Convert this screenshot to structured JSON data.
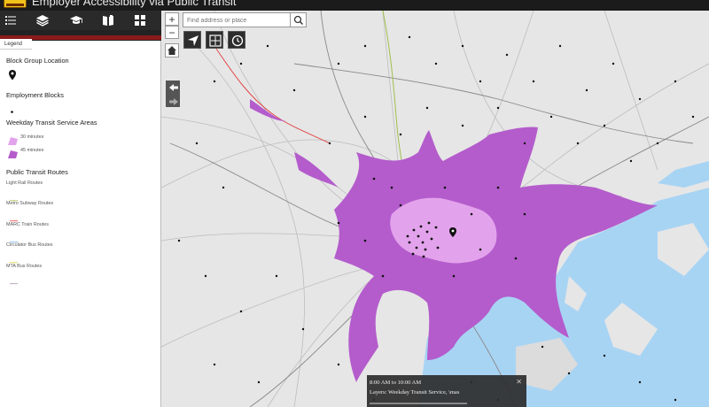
{
  "app": {
    "title": "Employer Accessibility via Public Transit"
  },
  "toolbar": {
    "icons": [
      "legend-list-icon",
      "layers-icon",
      "graduation-cap-icon",
      "bookmark-icon",
      "basemap-grid-icon"
    ]
  },
  "legend": {
    "tab_label": "Legend",
    "sections": [
      {
        "heading": "Block Group Location",
        "items": []
      },
      {
        "heading": "Employment Blocks",
        "items": []
      },
      {
        "heading": "Weekday Transit Service Areas",
        "items": [
          "30 minutes",
          "45 minutes"
        ]
      },
      {
        "heading": "Public Transit Routes",
        "items": [
          "Light Rail Routes",
          "Metro Subway Routes",
          "MARC Train Routes",
          "Circulator Bus Routes",
          "MTA Bus Routes"
        ]
      }
    ],
    "colors": {
      "light_rail": "#c9d98a",
      "metro_subway": "#f08080",
      "marc_train": "#9ec6e6",
      "circulator_bus": "#e8e37a",
      "mta_bus": "#c9b3c9",
      "service_30": "#e3a3ec",
      "service_45": "#b45ccc"
    }
  },
  "search": {
    "placeholder": "Find address or place"
  },
  "map_controls": {
    "zoom_in": "+",
    "zoom_out": "−"
  },
  "info_popup": {
    "time": "8:00 AM to 10:00 AM",
    "layer": "Layers: Weekday Transit Service, \\mas"
  }
}
